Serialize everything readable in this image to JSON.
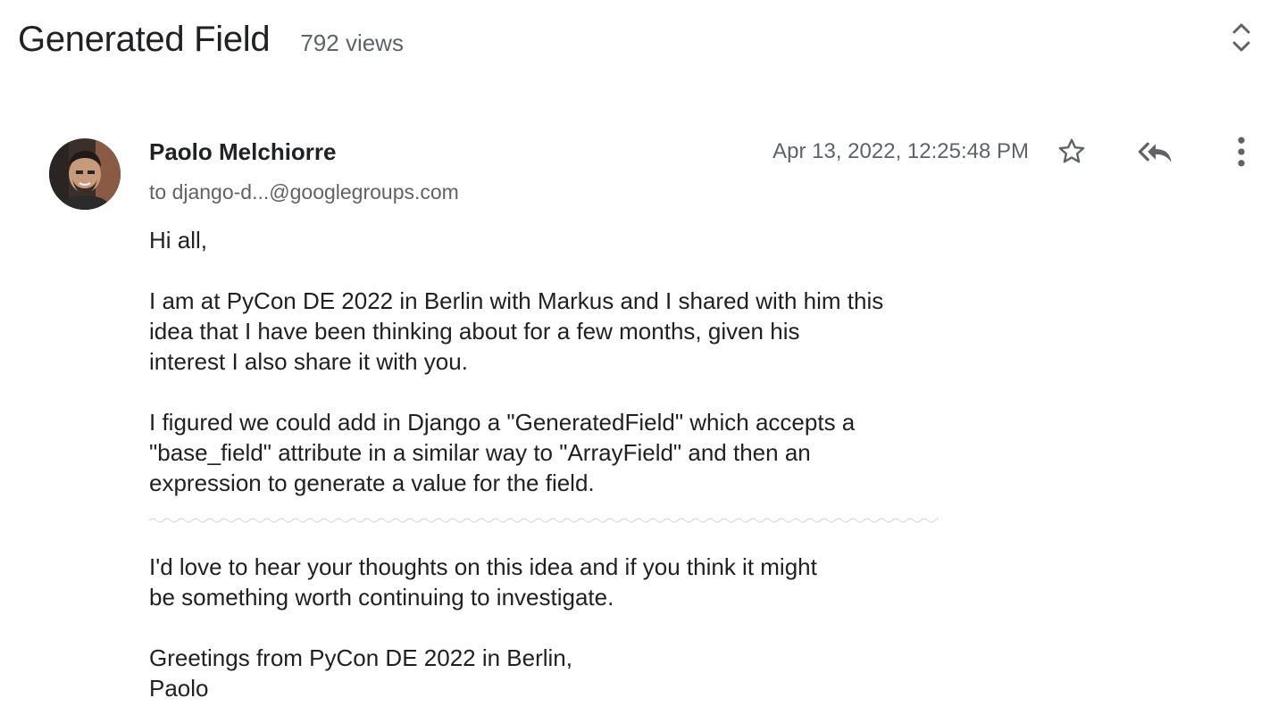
{
  "thread": {
    "title": "Generated Field",
    "views": "792 views"
  },
  "message": {
    "sender": "Paolo Melchiorre",
    "recipient": "to django-d...@googlegroups.com",
    "timestamp": "Apr 13, 2022, 12:25:48 PM",
    "greeting": "Hi all,",
    "paragraph1": {
      "line1": "I am at PyCon DE 2022 in Berlin with Markus and I shared with him this",
      "line2": "idea that I have been thinking about for a few months, given his",
      "line3": "interest I also share it with you."
    },
    "paragraph2": {
      "line1": "I figured we could add in Django a \"GeneratedField\" which accepts a",
      "line2": "\"base_field\" attribute in a similar way to \"ArrayField\" and then an",
      "line3": "expression to generate a value for the field."
    },
    "paragraph3": {
      "line1": "I'd love to hear your thoughts on this idea and if you think it might",
      "line2": "be something worth continuing to investigate."
    },
    "closing": "Greetings from PyCon DE 2022 in Berlin,",
    "signature": "Paolo"
  },
  "icons": {
    "expand": "unfold-more-icon",
    "star": "star-outline-icon",
    "reply_all": "reply-all-icon",
    "more": "more-vert-icon",
    "avatar": "avatar-photo"
  },
  "colors": {
    "primary_text": "#202124",
    "secondary_text": "#5f6368",
    "icon": "#5f6368",
    "divider": "#dadce0"
  }
}
